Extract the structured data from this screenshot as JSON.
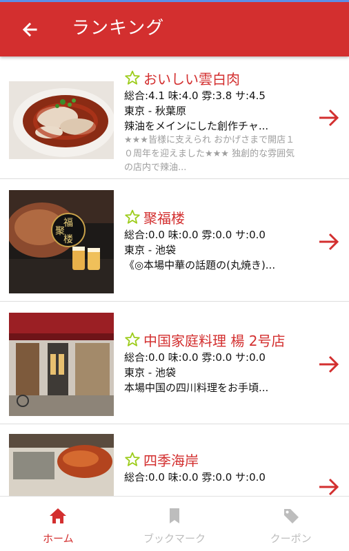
{
  "appbar": {
    "title": "ランキング",
    "back_icon": "arrow-back-icon"
  },
  "colors": {
    "primary": "#d32f2f",
    "star": "#9ccc1a",
    "description": "#9e9e9e"
  },
  "restaurants": [
    {
      "name": "おいしい雲白肉",
      "ratings": "総合:4.1 味:4.0 雰:3.8 サ:4.5",
      "location": "東京 - 秋葉原",
      "catch": "辣油をメインにした創作チャ...",
      "description": "★★★皆様に支えられ おかげさまで開店１０周年を迎えました★★★ 独創的な雰囲気の店内で辣油..."
    },
    {
      "name": "聚福楼",
      "ratings": "総合:0.0 味:0.0 雰:0.0 サ:0.0",
      "location": "東京 - 池袋",
      "catch": "《◎本場中華の話題の(丸焼き)...",
      "description": ""
    },
    {
      "name": "中国家庭料理 楊 2号店",
      "ratings": "総合:0.0 味:0.0 雰:0.0 サ:0.0",
      "location": "東京 - 池袋",
      "catch": "本場中国の四川料理をお手頃...",
      "description": ""
    },
    {
      "name": "四季海岸",
      "ratings": "総合:0.0 味:0.0 雰:0.0 サ:0.0",
      "location": "",
      "catch": "",
      "description": ""
    }
  ],
  "thumb_text": {
    "logo_top": "福",
    "logo_left": "聚",
    "logo_bottom": "楼"
  },
  "bottom_nav": [
    {
      "label": "ホーム",
      "icon": "home-icon",
      "active": true
    },
    {
      "label": "ブックマーク",
      "icon": "bookmark-icon",
      "active": false
    },
    {
      "label": "クーポン",
      "icon": "tag-icon",
      "active": false
    }
  ]
}
